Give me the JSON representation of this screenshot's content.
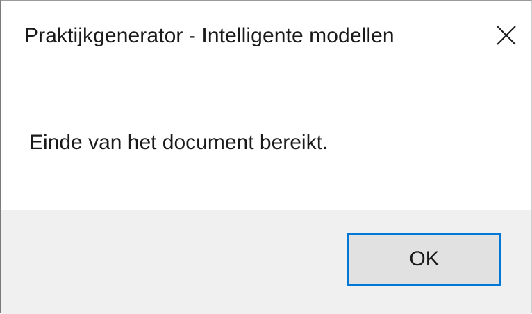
{
  "window": {
    "title": "Praktijkgenerator - Intelligente modellen",
    "close_icon": "close-icon"
  },
  "dialog": {
    "message": "Einde van het document bereikt."
  },
  "footer": {
    "ok_label": "OK"
  },
  "colors": {
    "footer_background": "#f0f0f0",
    "button_background": "#e1e1e1",
    "button_focus_border": "#0078d7",
    "text": "#1a1a1a"
  }
}
